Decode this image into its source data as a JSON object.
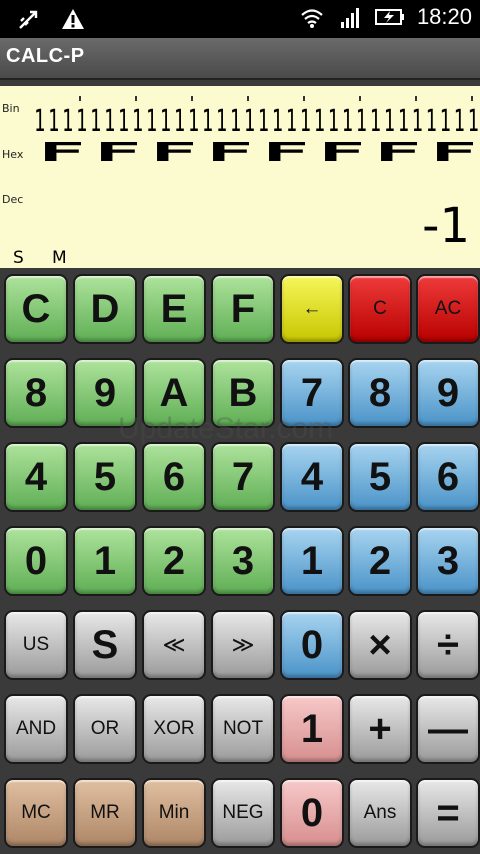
{
  "status_bar": {
    "time": "18:20",
    "icons": [
      "usb-debug-icon",
      "warning-icon",
      "wifi-icon",
      "signal-icon",
      "battery-charging-icon"
    ]
  },
  "app": {
    "title": "CALC-P"
  },
  "display": {
    "bin_label": "Bin",
    "hex_label": "Hex",
    "dec_label": "Dec",
    "bin_value": "11111111111111111111111111111111",
    "hex_digits": [
      "F",
      "F",
      "F",
      "F",
      "F",
      "F",
      "F",
      "F"
    ],
    "dec_value": "-1",
    "indicators": {
      "s": "S",
      "m": "M"
    }
  },
  "keypad": {
    "rows": [
      [
        {
          "label": "C",
          "color": "green"
        },
        {
          "label": "D",
          "color": "green"
        },
        {
          "label": "E",
          "color": "green"
        },
        {
          "label": "F",
          "color": "green"
        },
        {
          "label": "←",
          "color": "yellow"
        },
        {
          "label": "C",
          "color": "red"
        },
        {
          "label": "AC",
          "color": "red"
        }
      ],
      [
        {
          "label": "8",
          "color": "green"
        },
        {
          "label": "9",
          "color": "green"
        },
        {
          "label": "A",
          "color": "green"
        },
        {
          "label": "B",
          "color": "green"
        },
        {
          "label": "7",
          "color": "blue"
        },
        {
          "label": "8",
          "color": "blue"
        },
        {
          "label": "9",
          "color": "blue"
        }
      ],
      [
        {
          "label": "4",
          "color": "green"
        },
        {
          "label": "5",
          "color": "green"
        },
        {
          "label": "6",
          "color": "green"
        },
        {
          "label": "7",
          "color": "green"
        },
        {
          "label": "4",
          "color": "blue"
        },
        {
          "label": "5",
          "color": "blue"
        },
        {
          "label": "6",
          "color": "blue"
        }
      ],
      [
        {
          "label": "0",
          "color": "green"
        },
        {
          "label": "1",
          "color": "green"
        },
        {
          "label": "2",
          "color": "green"
        },
        {
          "label": "3",
          "color": "green"
        },
        {
          "label": "1",
          "color": "blue"
        },
        {
          "label": "2",
          "color": "blue"
        },
        {
          "label": "3",
          "color": "blue"
        }
      ],
      [
        {
          "label": "US",
          "color": "gray"
        },
        {
          "label": "S",
          "color": "gray"
        },
        {
          "label": "≪",
          "color": "gray"
        },
        {
          "label": "≫",
          "color": "gray"
        },
        {
          "label": "0",
          "color": "blue"
        },
        {
          "label": "×",
          "color": "gray"
        },
        {
          "label": "÷",
          "color": "gray"
        }
      ],
      [
        {
          "label": "AND",
          "color": "gray"
        },
        {
          "label": "OR",
          "color": "gray"
        },
        {
          "label": "XOR",
          "color": "gray"
        },
        {
          "label": "NOT",
          "color": "gray"
        },
        {
          "label": "1",
          "color": "pink"
        },
        {
          "label": "+",
          "color": "gray"
        },
        {
          "label": "—",
          "color": "gray"
        }
      ],
      [
        {
          "label": "MC",
          "color": "tan"
        },
        {
          "label": "MR",
          "color": "tan"
        },
        {
          "label": "Min",
          "color": "tan"
        },
        {
          "label": "NEG",
          "color": "gray"
        },
        {
          "label": "0",
          "color": "pink"
        },
        {
          "label": "Ans",
          "color": "gray"
        },
        {
          "label": "=",
          "color": "gray"
        }
      ]
    ]
  },
  "watermark": "UpdateStar.com"
}
